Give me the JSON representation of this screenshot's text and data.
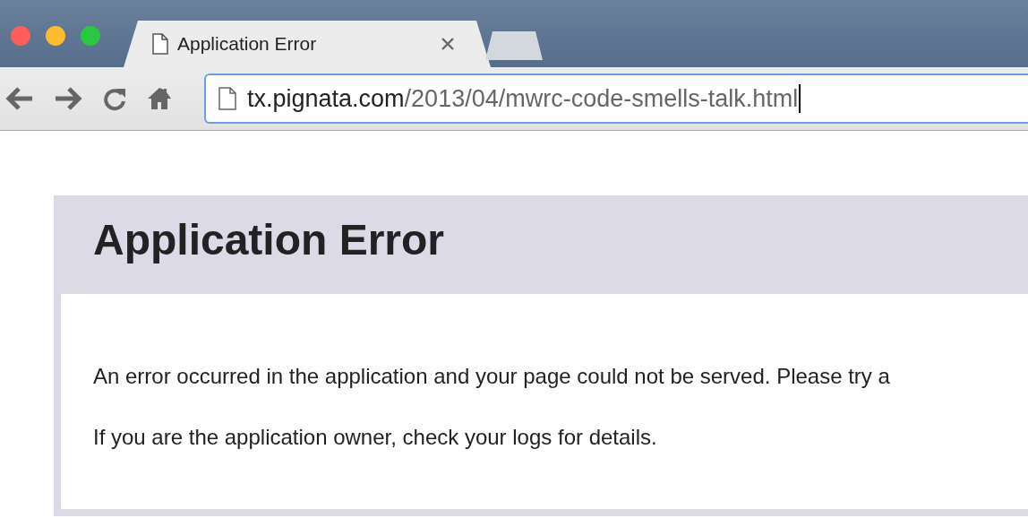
{
  "tabs": [
    {
      "title": "Application Error",
      "selected": true
    }
  ],
  "address_bar": {
    "host": "tx.pignata.com",
    "path": "/2013/04/mwrc-code-smells-talk.html"
  },
  "page": {
    "heading": "Application Error",
    "paragraphs": [
      "An error occurred in the application and your page could not be served. Please try a",
      "If you are the application owner, check your logs for details."
    ]
  }
}
